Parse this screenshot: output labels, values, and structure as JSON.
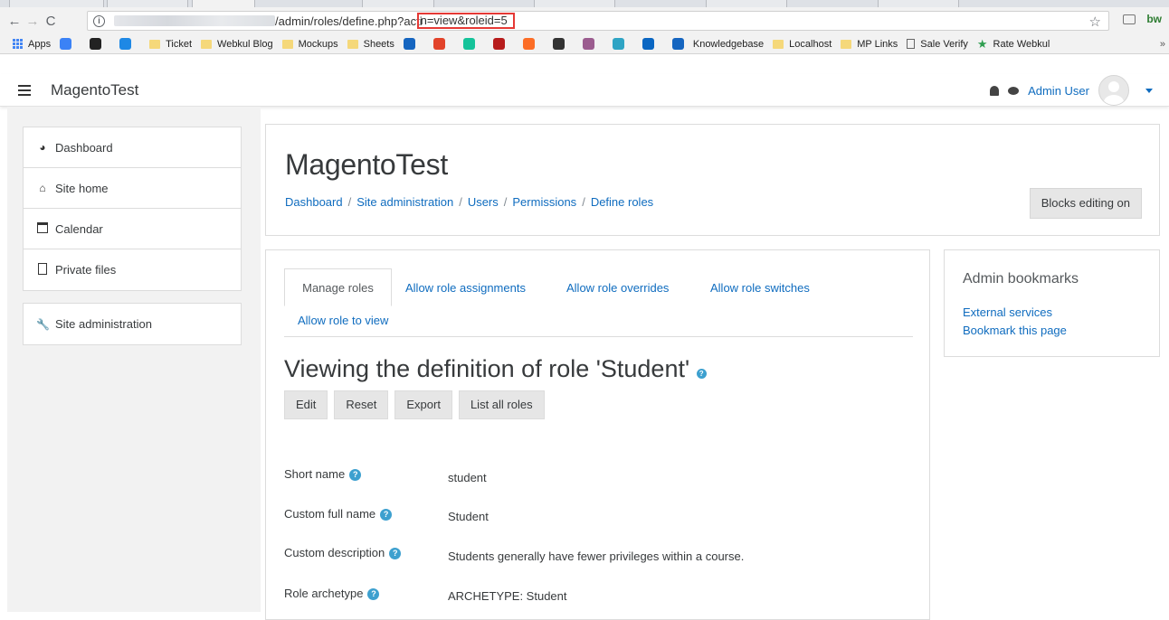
{
  "browser": {
    "url_visible": "/admin/roles/define.php?action=view&roleid=5",
    "url_prefix": "/admin/roles/define.php?acti",
    "url_highlighted": "n=view&roleid=5",
    "bookmarks": [
      {
        "label": "Apps",
        "kind": "apps"
      },
      {
        "label": "",
        "kind": "fav",
        "color": "#3b82f6"
      },
      {
        "label": "",
        "kind": "fav",
        "color": "#222222"
      },
      {
        "label": "",
        "kind": "fav",
        "color": "#1e88e5"
      },
      {
        "label": "Ticket",
        "kind": "folder"
      },
      {
        "label": "Webkul Blog",
        "kind": "folder"
      },
      {
        "label": "Mockups",
        "kind": "folder"
      },
      {
        "label": "Sheets",
        "kind": "folder"
      },
      {
        "label": "",
        "kind": "fav",
        "color": "#1565c0"
      },
      {
        "label": "",
        "kind": "fav",
        "color": "#e2432a"
      },
      {
        "label": "",
        "kind": "fav",
        "color": "#15c39a"
      },
      {
        "label": "",
        "kind": "fav",
        "color": "#b71c1c"
      },
      {
        "label": "",
        "kind": "fav",
        "color": "#fc6d26"
      },
      {
        "label": "",
        "kind": "fav",
        "color": "#333333"
      },
      {
        "label": "",
        "kind": "fav",
        "color": "#9b5c8f"
      },
      {
        "label": "",
        "kind": "fav",
        "color": "#2fa4c4"
      },
      {
        "label": "",
        "kind": "fav",
        "color": "#0a66c2"
      },
      {
        "label": "Knowledgebase",
        "kind": "fav",
        "color": "#1565c0"
      },
      {
        "label": "Localhost",
        "kind": "folder"
      },
      {
        "label": "MP Links",
        "kind": "folder"
      },
      {
        "label": "Sale Verify",
        "kind": "page"
      },
      {
        "label": "Rate Webkul",
        "kind": "star"
      }
    ],
    "bookmarks_more": "»",
    "ext_label": "bw"
  },
  "navbar": {
    "brand": "MagentoTest",
    "user_name": "Admin User"
  },
  "drawer": {
    "items": [
      {
        "label": "Dashboard",
        "icon": "dashboard-icon"
      },
      {
        "label": "Site home",
        "icon": "home-icon"
      },
      {
        "label": "Calendar",
        "icon": "calendar-icon"
      },
      {
        "label": "Private files",
        "icon": "file-icon"
      }
    ],
    "admin_item": {
      "label": "Site administration",
      "icon": "wrench-icon"
    }
  },
  "header": {
    "title": "MagentoTest",
    "breadcrumb": [
      "Dashboard",
      "Site administration",
      "Users",
      "Permissions",
      "Define roles"
    ],
    "blocks_button": "Blocks editing on"
  },
  "main": {
    "tabs": [
      "Manage roles",
      "Allow role assignments",
      "Allow role overrides",
      "Allow role switches",
      "Allow role to view"
    ],
    "heading": "Viewing the definition of role 'Student'",
    "actions": [
      "Edit",
      "Reset",
      "Export",
      "List all roles"
    ],
    "fields": [
      {
        "label": "Short name",
        "value": "student"
      },
      {
        "label": "Custom full name",
        "value": "Student"
      },
      {
        "label": "Custom description",
        "value": "Students generally have fewer privileges within a course."
      },
      {
        "label": "Role archetype",
        "value": "ARCHETYPE: Student"
      }
    ]
  },
  "sideblock": {
    "title": "Admin bookmarks",
    "links": [
      "External services",
      "Bookmark this page"
    ]
  },
  "colors": {
    "link": "#0f6cbf",
    "help": "#3da0cf",
    "highlight": "#e53935"
  }
}
